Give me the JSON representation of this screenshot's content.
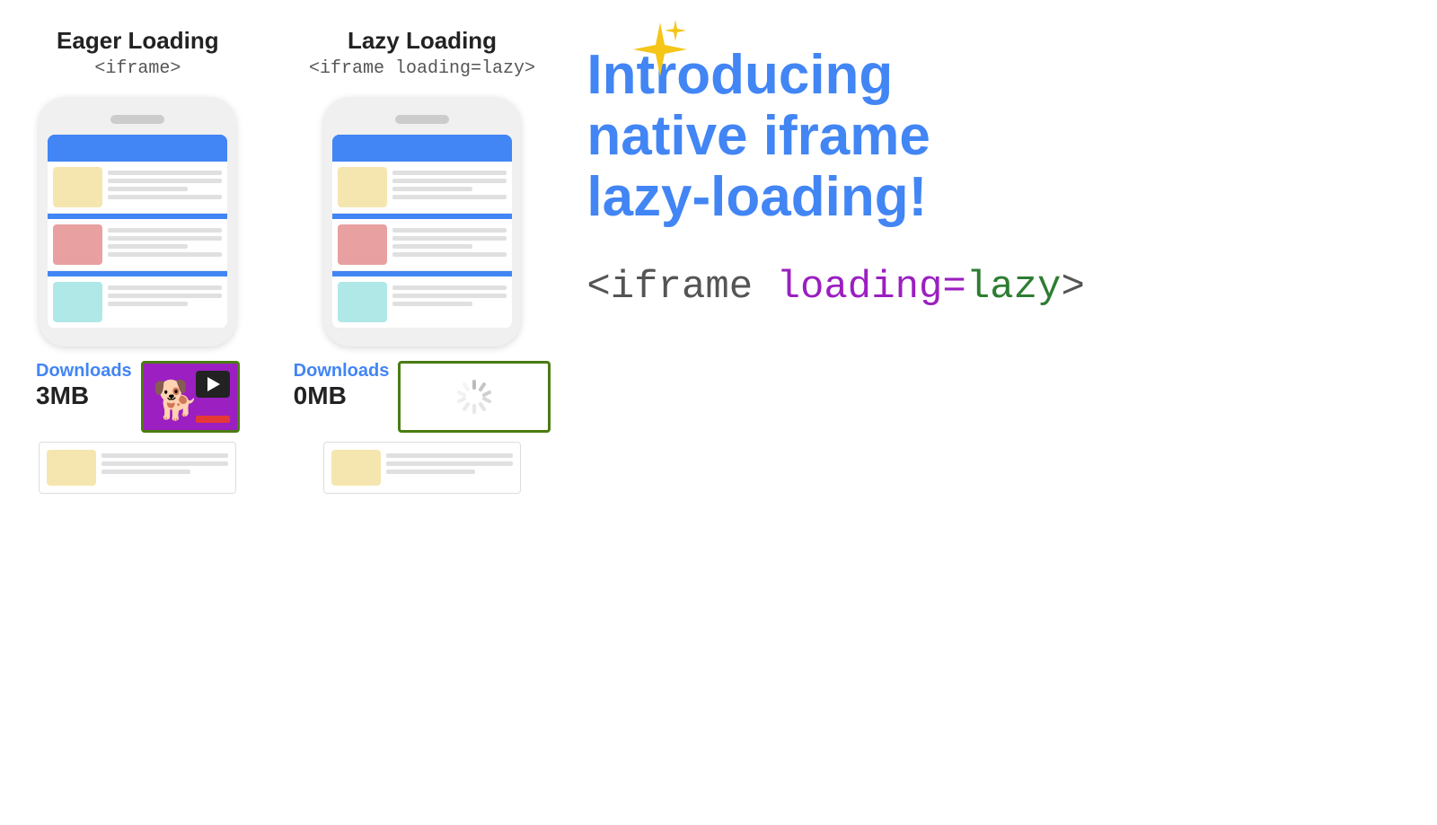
{
  "eager": {
    "title": "Eager Loading",
    "subtitle": "<iframe>",
    "downloads_label": "Downloads",
    "downloads_amount": "3MB"
  },
  "lazy": {
    "title": "Lazy Loading",
    "subtitle": "<iframe loading=lazy>",
    "downloads_label": "Downloads",
    "downloads_amount": "0MB"
  },
  "introducing": {
    "line1": "Introducing",
    "line2": "native iframe",
    "line3": "lazy-loading!"
  },
  "code_example": "<iframe loading=lazy>",
  "code_parts": {
    "prefix": "<iframe ",
    "attr_name": "loading=",
    "attr_value": "lazy",
    "suffix": ">"
  },
  "colors": {
    "blue": "#4285f4",
    "purple": "#9b1fc1",
    "green": "#2e7d32",
    "dark_green_border": "#4a7c12",
    "yellow": "#f5e6b0",
    "sparkle": "#f5c518"
  }
}
